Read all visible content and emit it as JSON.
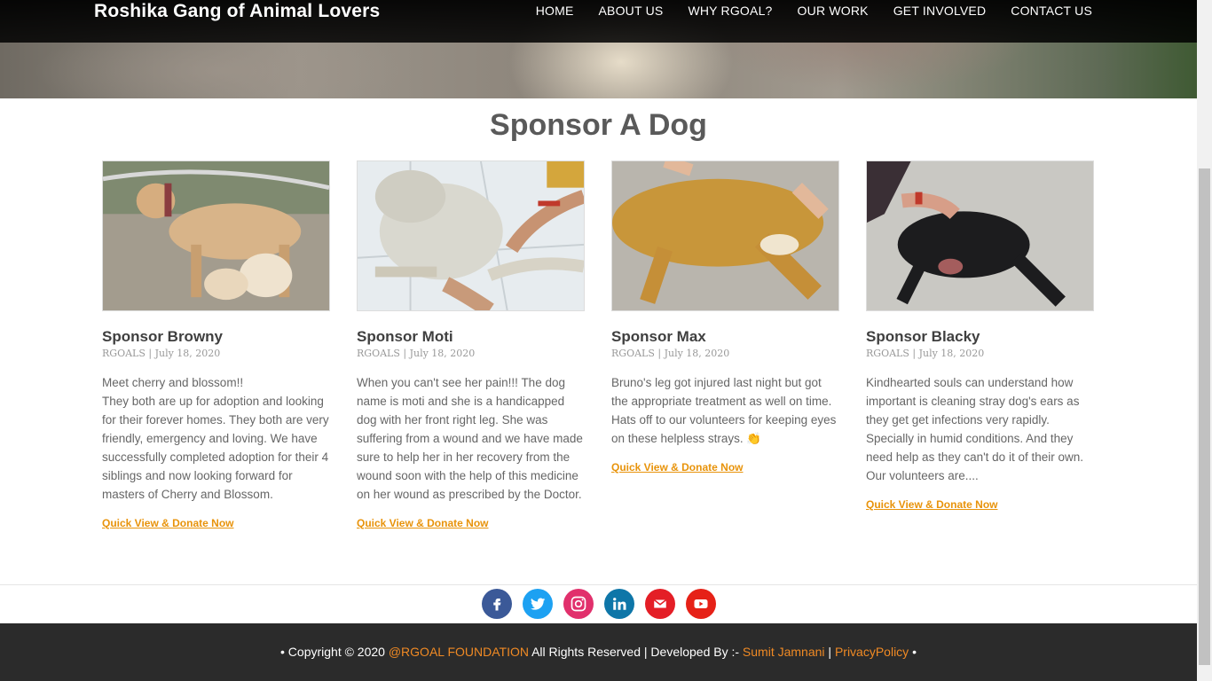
{
  "brand": "Roshika Gang of Animal Lovers",
  "nav": [
    "HOME",
    "ABOUT US",
    "WHY RGOAL?",
    "OUR WORK",
    "GET INVOLVED",
    "CONTACT US"
  ],
  "page_title": "Sponsor A Dog",
  "cards": [
    {
      "title": "Sponsor Browny",
      "meta": "RGOALS | July 18, 2020",
      "text": "Meet cherry and blossom!!\nThey both are up for adoption and looking for their forever homes. They both are very friendly, emergency and loving. We have successfully completed adoption for their 4 siblings and now looking forward for masters of Cherry and Blossom.",
      "link": "Quick View & Donate Now"
    },
    {
      "title": "Sponsor Moti",
      "meta": "RGOALS | July 18, 2020",
      "text": "When you can't see her pain!!! The dog name is moti and she is a handicapped dog with her front right leg. She was suffering from a wound and we have made sure to help her in her recovery from the wound soon with the help of this medicine on her wound as prescribed by the Doctor.",
      "link": "Quick View & Donate Now"
    },
    {
      "title": "Sponsor Max",
      "meta": "RGOALS | July 18, 2020",
      "text": "Bruno's leg got injured last night but got the appropriate treatment as well on time. Hats off to our volunteers for keeping eyes on these helpless strays. 👏",
      "link": "Quick View & Donate Now"
    },
    {
      "title": "Sponsor Blacky",
      "meta": "RGOALS | July 18, 2020",
      "text": "Kindhearted souls can understand how important is cleaning stray dog's ears as they get get infections very rapidly. Specially in humid conditions. And they need help as they can't do it of their own. Our volunteers are....",
      "link": "Quick View & Donate Now"
    }
  ],
  "social": [
    {
      "icon": "facebook-icon",
      "color": "#3b5998"
    },
    {
      "icon": "twitter-icon",
      "color": "#1da1f2"
    },
    {
      "icon": "instagram-icon",
      "color": "#e1306c"
    },
    {
      "icon": "linkedin-icon",
      "color": "#0e76a8"
    },
    {
      "icon": "email-icon",
      "color": "#e41e26"
    },
    {
      "icon": "youtube-icon",
      "color": "#e62117"
    }
  ],
  "footer": {
    "prefix": "• Copyright © 2020 ",
    "org": "@RGOAL FOUNDATION",
    "middle": " All Rights Reserved | Developed By :- ",
    "developer": "Sumit Jamnani",
    "sep": " | ",
    "privacy": "PrivacyPolicy",
    "suffix": " •"
  }
}
